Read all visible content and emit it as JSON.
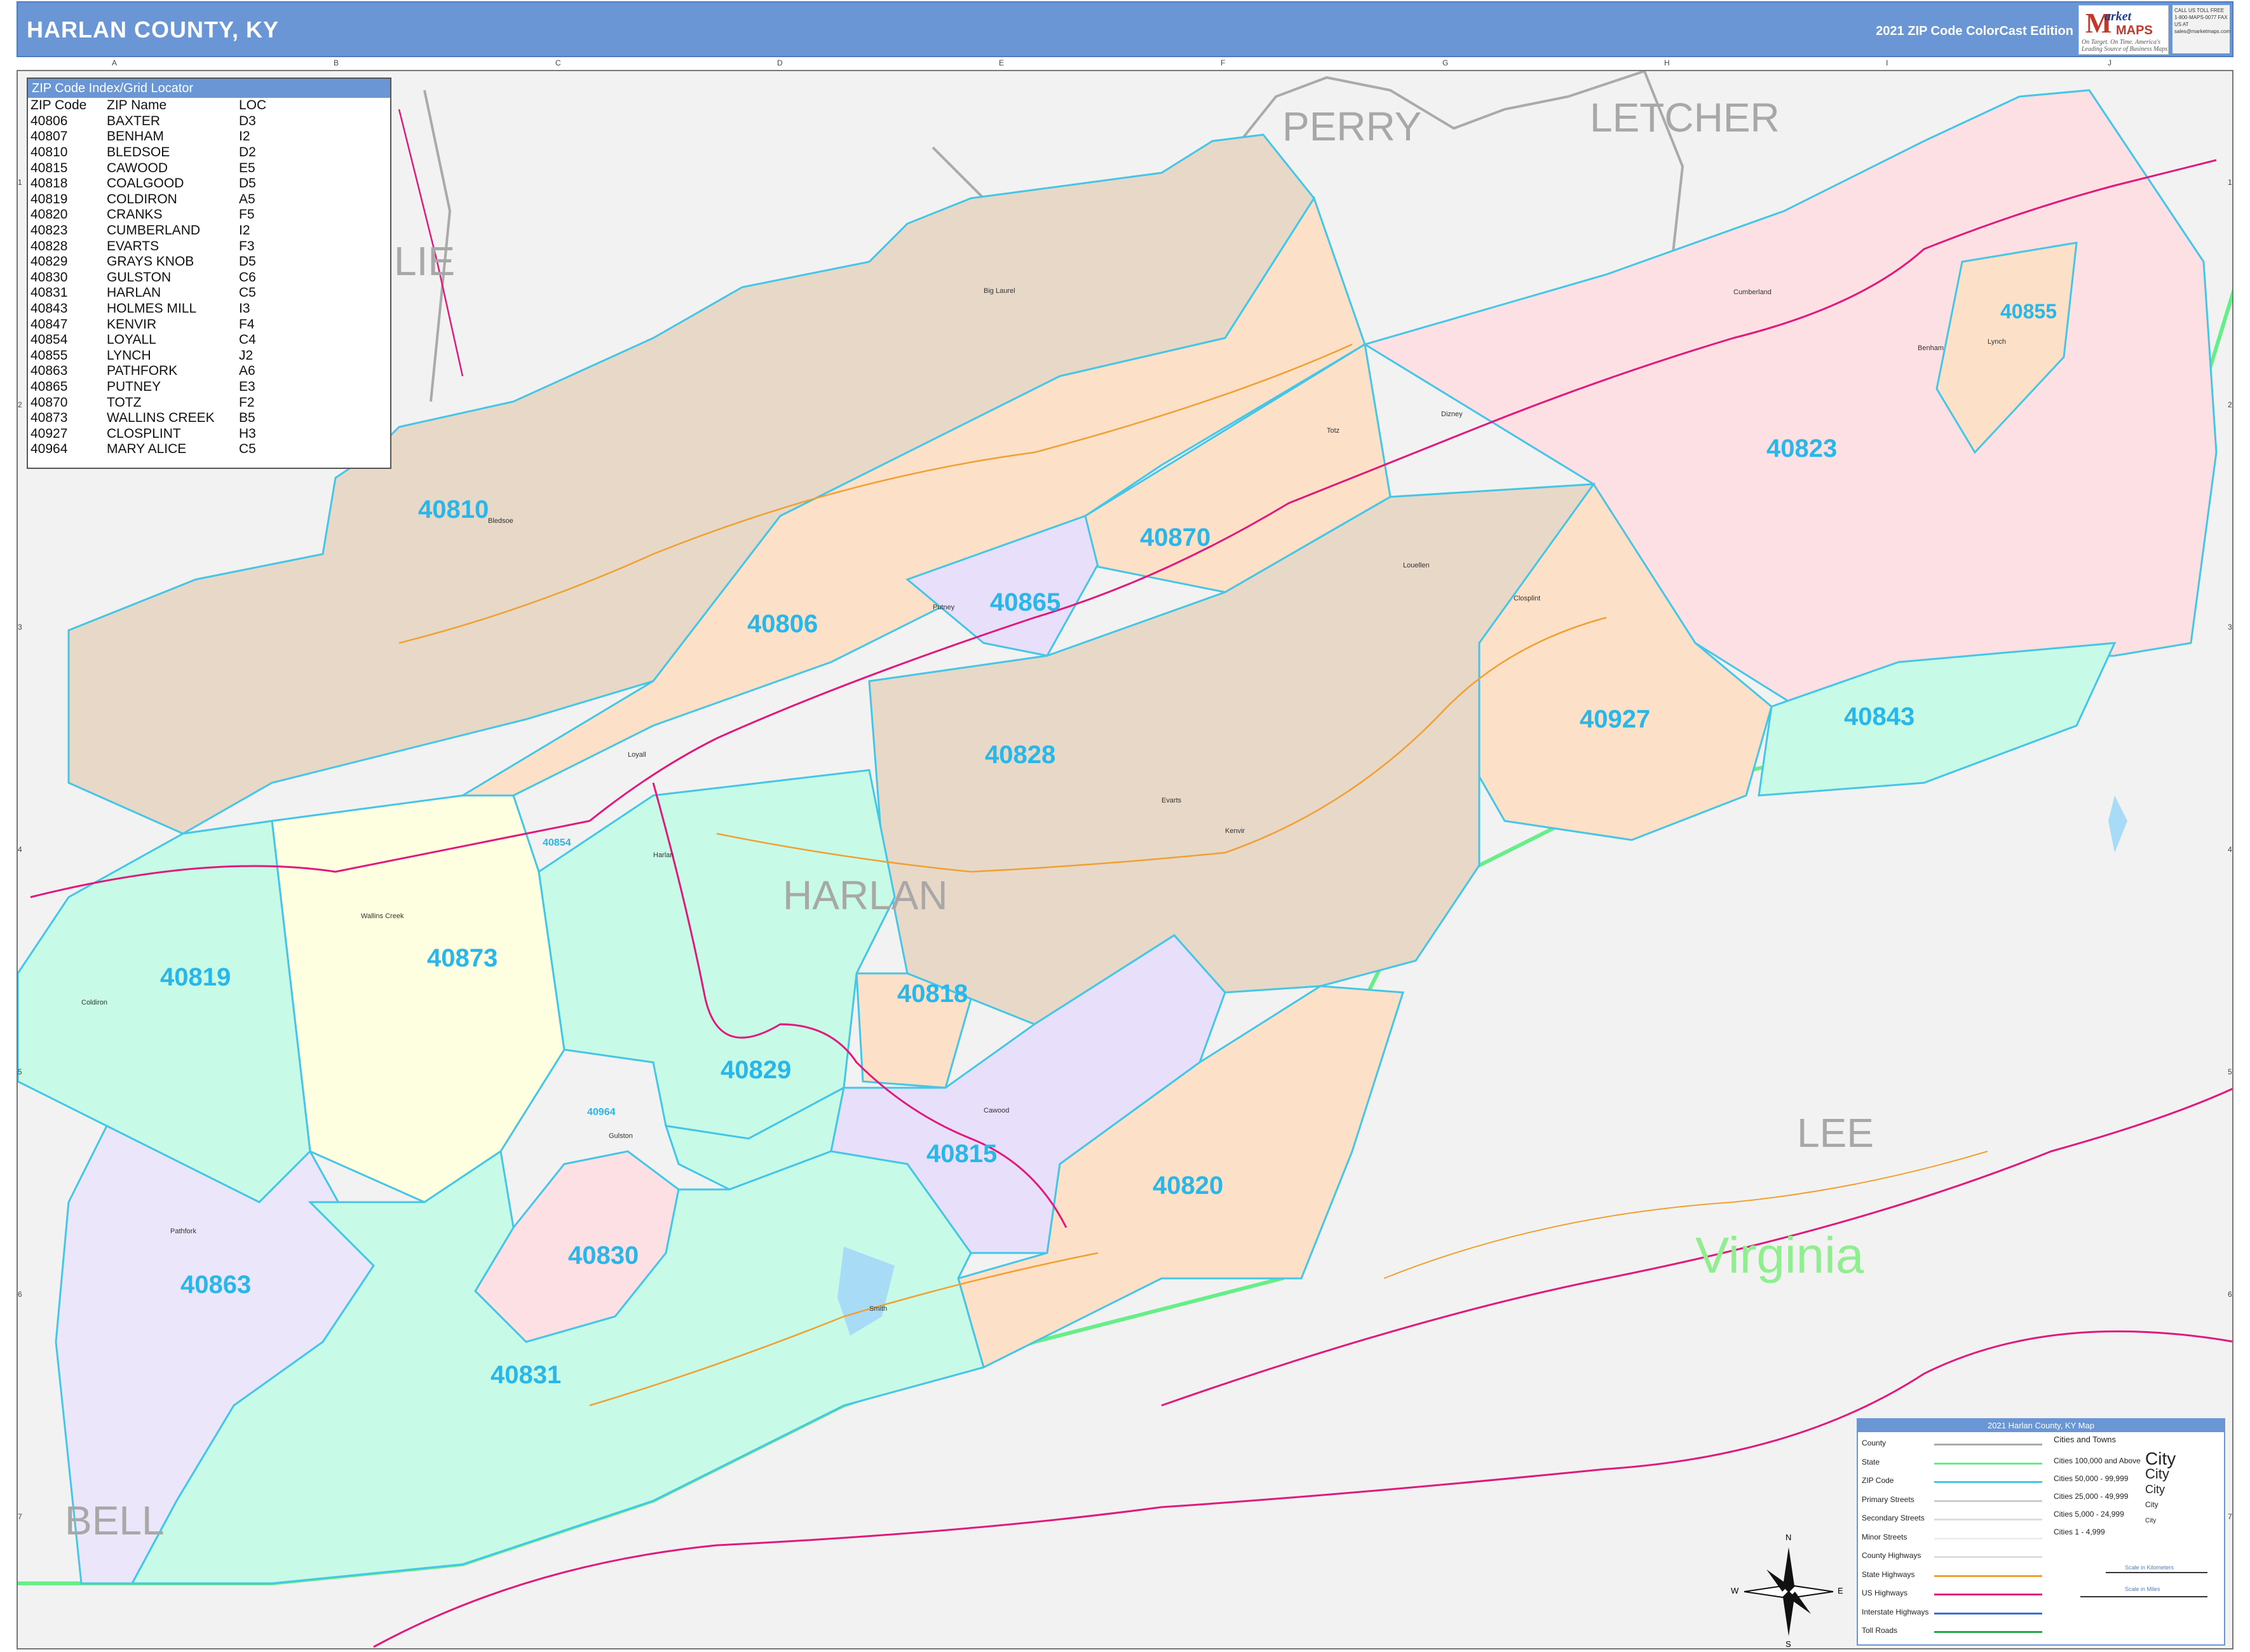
{
  "header": {
    "title": "HARLAN COUNTY, KY",
    "edition": "2021 ZIP Code ColorCast Edition",
    "logo_text": "Market MAPS",
    "logo_tagline": "On Target. On Time. America's Leading Source of Business Maps",
    "contact": "CALL US TOLL FREE 1-800-MAPS-0077 FAX US AT sales@marketmaps.com"
  },
  "colors": {
    "header_bg": "#6a96d6",
    "zip_label": "#29b6e8",
    "county_label": "#a8a8a8",
    "state_label": "#90ee90",
    "zip_boundary": "#45c6e6",
    "background": "#f2f2f2",
    "us_highway": "#e0197d",
    "state_highway": "#f0a030",
    "state_line": "#66ee88",
    "county_line": "#aaaaaa"
  },
  "grid": {
    "columns": [
      "A",
      "B",
      "C",
      "D",
      "E",
      "F",
      "G",
      "H",
      "I",
      "J"
    ],
    "rows": [
      "1",
      "2",
      "3",
      "4",
      "5",
      "6",
      "7"
    ]
  },
  "zip_index": {
    "title": "ZIP Code Index/Grid Locator",
    "headers": [
      "ZIP Code",
      "ZIP Name",
      "LOC"
    ],
    "rows": [
      [
        "40806",
        "BAXTER",
        "D3"
      ],
      [
        "40807",
        "BENHAM",
        "I2"
      ],
      [
        "40810",
        "BLEDSOE",
        "D2"
      ],
      [
        "40815",
        "CAWOOD",
        "E5"
      ],
      [
        "40818",
        "COALGOOD",
        "D5"
      ],
      [
        "40819",
        "COLDIRON",
        "A5"
      ],
      [
        "40820",
        "CRANKS",
        "F5"
      ],
      [
        "40823",
        "CUMBERLAND",
        "I2"
      ],
      [
        "40828",
        "EVARTS",
        "F3"
      ],
      [
        "40829",
        "GRAYS KNOB",
        "D5"
      ],
      [
        "40830",
        "GULSTON",
        "C6"
      ],
      [
        "40831",
        "HARLAN",
        "C5"
      ],
      [
        "40843",
        "HOLMES MILL",
        "I3"
      ],
      [
        "40847",
        "KENVIR",
        "F4"
      ],
      [
        "40854",
        "LOYALL",
        "C4"
      ],
      [
        "40855",
        "LYNCH",
        "J2"
      ],
      [
        "40863",
        "PATHFORK",
        "A6"
      ],
      [
        "40865",
        "PUTNEY",
        "E3"
      ],
      [
        "40870",
        "TOTZ",
        "F2"
      ],
      [
        "40873",
        "WALLINS CREEK",
        "B5"
      ],
      [
        "40927",
        "CLOSPLINT",
        "H3"
      ],
      [
        "40964",
        "MARY ALICE",
        "C5"
      ]
    ]
  },
  "labels": {
    "counties": [
      "PERRY",
      "LETCHER",
      "LIE",
      "HARLAN",
      "LEE",
      "BELL"
    ],
    "state": "Virginia",
    "zips": [
      "40810",
      "40806",
      "40865",
      "40870",
      "40823",
      "40855",
      "40927",
      "40843",
      "40828",
      "40818",
      "40873",
      "40819",
      "40829",
      "40815",
      "40820",
      "40830",
      "40863",
      "40831",
      "40854",
      "40964"
    ],
    "towns": [
      "Big Laurel",
      "Bledsoe",
      "Putney",
      "Totz",
      "Dizney",
      "Cumberland",
      "Benham",
      "Lynch",
      "Closplint",
      "Louellen",
      "Harlan",
      "Loyall",
      "Evarts",
      "Kenvir",
      "Cawood",
      "Wallins Creek",
      "Coldiron",
      "Pathfork",
      "Gulston",
      "Smith"
    ]
  },
  "legend": {
    "title": "2021 Harlan County, KY Map",
    "left_items": [
      "County",
      "State",
      "ZIP Code",
      "Primary Streets",
      "Secondary Streets",
      "Minor Streets",
      "County Highways",
      "State Highways",
      "US Highways",
      "Interstate Highways",
      "Toll Roads"
    ],
    "right_title": "Cities and Towns",
    "right_items": [
      "Cities 100,000 and Above",
      "Cities 50,000 - 99,999",
      "Cities 25,000 - 49,999",
      "Cities 5,000 - 24,999",
      "Cities 1 - 4,999"
    ],
    "city_samples": [
      "City",
      "City",
      "City",
      "City",
      "City"
    ],
    "scale_km": "Scale in Kilometers",
    "scale_mi": "Scale in Miles"
  },
  "compass": {
    "n": "N",
    "s": "S",
    "e": "E",
    "w": "W"
  }
}
